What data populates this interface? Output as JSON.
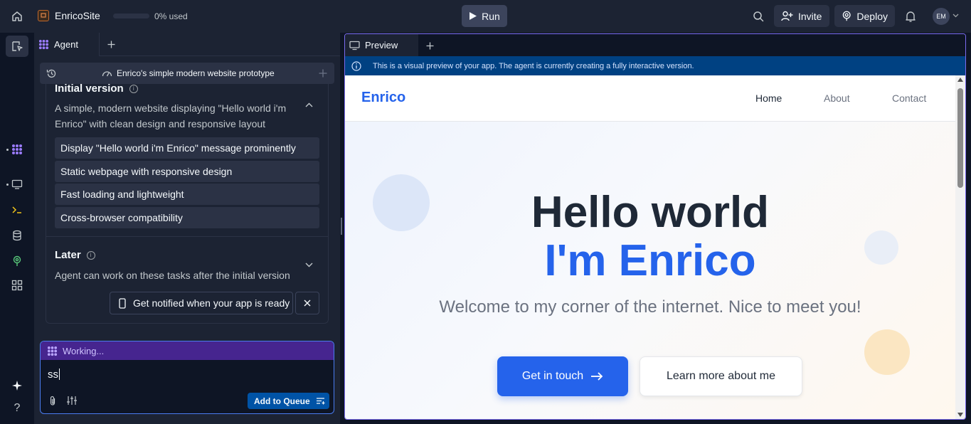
{
  "topbar": {
    "repl_name": "EnricoSite",
    "usage_percent": 0,
    "usage_text": "0% used",
    "run_label": "Run",
    "invite_label": "Invite",
    "deploy_label": "Deploy",
    "avatar_initials": "EM"
  },
  "rail": {
    "items": [
      "files-icon",
      "agent-icon",
      "preview-icon",
      "shell-icon",
      "database-icon",
      "deployments-icon",
      "apps-icon",
      "assistant-icon",
      "help-icon"
    ]
  },
  "agent": {
    "tab_label": "Agent",
    "session_title": "Enrico's simple modern website prototype",
    "initial": {
      "title": "Initial version",
      "description": "A simple, modern website displaying \"Hello world i'm Enrico\" with clean design and responsive layout",
      "tasks": [
        "Display \"Hello world i'm Enrico\" message prominently",
        "Static webpage with responsive design",
        "Fast loading and lightweight",
        "Cross-browser compatibility"
      ]
    },
    "later": {
      "title": "Later",
      "description": "Agent can work on these tasks after the initial version"
    },
    "notify_label": "Get notified when your app is ready",
    "composer": {
      "status": "Working...",
      "input_value": "ss",
      "queue_label": "Add to Queue"
    }
  },
  "preview": {
    "tab_label": "Preview",
    "banner_text": "This is a visual preview of your app. The agent is currently creating a fully interactive version.",
    "site": {
      "brand": "Enrico",
      "nav": [
        "Home",
        "About",
        "Contact"
      ],
      "active_nav": "Home",
      "hero_line1": "Hello world",
      "hero_line2": "I'm Enrico",
      "subtitle": "Welcome to my corner of the internet. Nice to meet you!",
      "cta_primary": "Get in touch",
      "cta_secondary": "Learn more about me"
    }
  },
  "colors": {
    "app_bg": "#0e1525",
    "panel_bg": "#1c2333",
    "accent_blue": "#2563eb",
    "working_purple": "#46258f",
    "banner_blue": "#004182",
    "queue_button": "#0053a6"
  }
}
